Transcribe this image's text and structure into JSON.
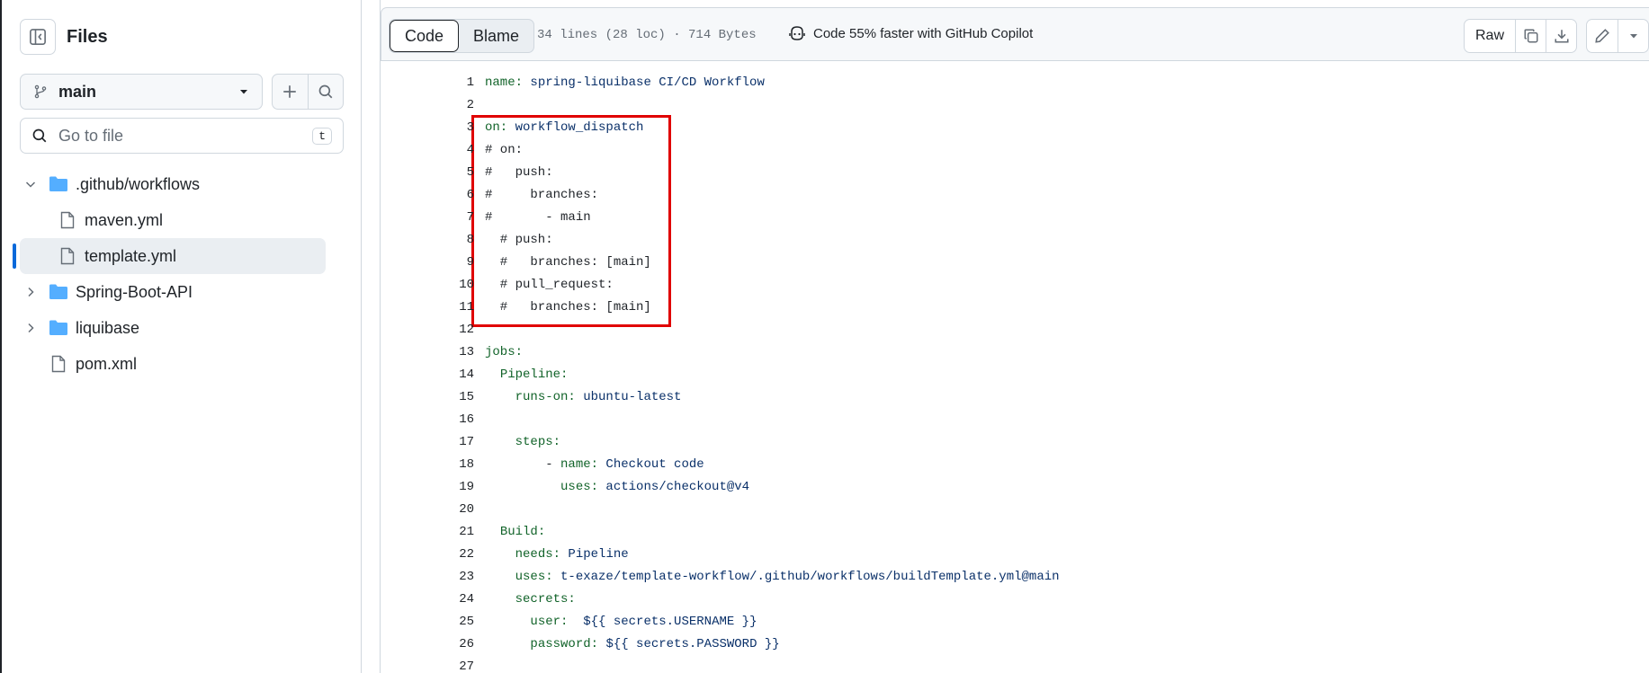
{
  "sidebar": {
    "title": "Files",
    "branch": "main",
    "search_placeholder": "Go to file",
    "search_shortcut": "t",
    "tree": [
      {
        "label": ".github/workflows",
        "type": "folder",
        "expanded": true
      },
      {
        "label": "maven.yml",
        "type": "file"
      },
      {
        "label": "template.yml",
        "type": "file",
        "selected": true
      },
      {
        "label": "Spring-Boot-API",
        "type": "folder",
        "expanded": false
      },
      {
        "label": "liquibase",
        "type": "folder",
        "expanded": false
      },
      {
        "label": "pom.xml",
        "type": "file"
      }
    ]
  },
  "toolbar": {
    "code_tab": "Code",
    "blame_tab": "Blame",
    "file_meta": "34 lines (28 loc) · 714 Bytes",
    "copilot_text": "Code 55% faster with GitHub Copilot",
    "raw_label": "Raw"
  },
  "code_lines": [
    {
      "n": "1",
      "text": "name: spring-liquibase CI/CD Workflow"
    },
    {
      "n": "2",
      "text": ""
    },
    {
      "n": "3",
      "text": "on: workflow_dispatch"
    },
    {
      "n": "4",
      "text": "# on:"
    },
    {
      "n": "5",
      "text": "#   push:"
    },
    {
      "n": "6",
      "text": "#     branches:"
    },
    {
      "n": "7",
      "text": "#       - main"
    },
    {
      "n": "8",
      "text": "  # push:"
    },
    {
      "n": "9",
      "text": "  #   branches: [main]"
    },
    {
      "n": "10",
      "text": "  # pull_request:"
    },
    {
      "n": "11",
      "text": "  #   branches: [main]"
    },
    {
      "n": "12",
      "text": ""
    },
    {
      "n": "13",
      "text": "jobs:"
    },
    {
      "n": "14",
      "text": "  Pipeline:"
    },
    {
      "n": "15",
      "text": "    runs-on: ubuntu-latest"
    },
    {
      "n": "16",
      "text": ""
    },
    {
      "n": "17",
      "text": "    steps:"
    },
    {
      "n": "18",
      "text": "        - name: Checkout code"
    },
    {
      "n": "19",
      "text": "          uses: actions/checkout@v4"
    },
    {
      "n": "20",
      "text": ""
    },
    {
      "n": "21",
      "text": "  Build:"
    },
    {
      "n": "22",
      "text": "    needs: Pipeline"
    },
    {
      "n": "23",
      "text": "    uses: t-exaze/template-workflow/.github/workflows/buildTemplate.yml@main"
    },
    {
      "n": "24",
      "text": "    secrets:"
    },
    {
      "n": "25",
      "text": "      user:  ${{ secrets.USERNAME }}"
    },
    {
      "n": "26",
      "text": "      password: ${{ secrets.PASSWORD }}"
    },
    {
      "n": "27",
      "text": ""
    }
  ],
  "colors": {
    "key": "#116329",
    "value": "#0a3069",
    "highlight_border": "#e00000",
    "folder": "#54aeff",
    "selection_bar": "#0969da"
  }
}
